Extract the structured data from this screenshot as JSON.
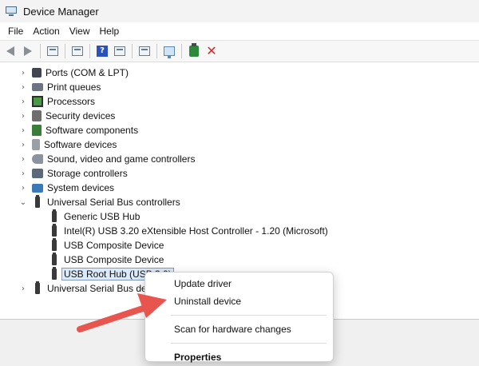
{
  "window": {
    "title": "Device Manager"
  },
  "menubar": {
    "items": [
      "File",
      "Action",
      "View",
      "Help"
    ]
  },
  "toolbar": {
    "delete_icon_glyph": "✕"
  },
  "tree": {
    "categories": [
      {
        "label": "Ports (COM & LPT)",
        "icon": "port-icon"
      },
      {
        "label": "Print queues",
        "icon": "printer-icon"
      },
      {
        "label": "Processors",
        "icon": "processor-icon"
      },
      {
        "label": "Security devices",
        "icon": "security-icon"
      },
      {
        "label": "Software components",
        "icon": "software-component-icon"
      },
      {
        "label": "Software devices",
        "icon": "software-device-icon"
      },
      {
        "label": "Sound, video and game controllers",
        "icon": "speaker-icon"
      },
      {
        "label": "Storage controllers",
        "icon": "storage-icon"
      },
      {
        "label": "System devices",
        "icon": "system-icon"
      }
    ],
    "usb_controllers": {
      "label": "Universal Serial Bus controllers",
      "children": [
        "Generic USB Hub",
        "Intel(R) USB 3.20 eXtensible Host Controller - 1.20 (Microsoft)",
        "USB Composite Device",
        "USB Composite Device",
        "USB Root Hub (USB 3.0)"
      ]
    },
    "usb_devices": {
      "label": "Universal Serial Bus devices"
    },
    "chevron_collapsed": "›",
    "chevron_expanded": "⌄"
  },
  "context_menu": {
    "update_driver": "Update driver",
    "uninstall_device": "Uninstall device",
    "scan_hardware": "Scan for hardware changes",
    "properties": "Properties"
  },
  "colors": {
    "annotation_arrow": "#e8554e",
    "selection": "#dbe9f8"
  }
}
